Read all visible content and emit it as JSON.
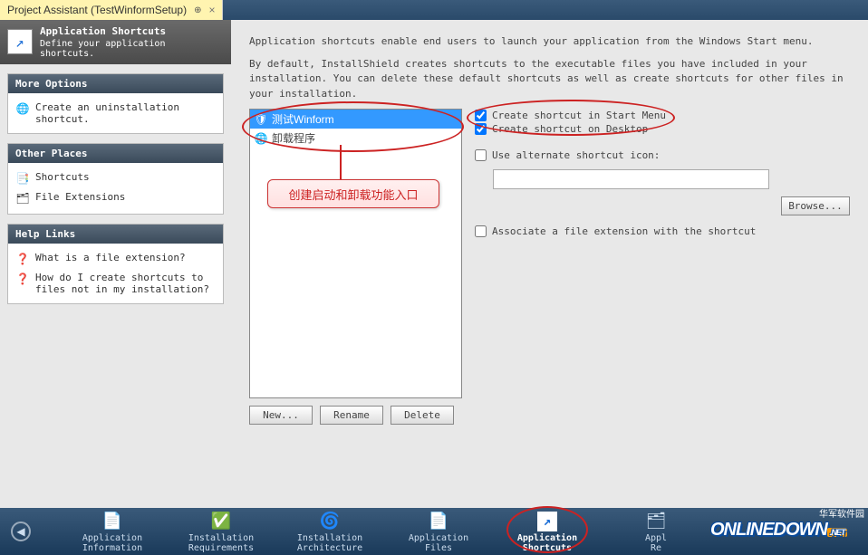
{
  "tab": {
    "title": "Project Assistant (TestWinformSetup)",
    "pin_glyph": "⊕",
    "close_glyph": "×"
  },
  "sidebar": {
    "header": {
      "title": "Application Shortcuts",
      "desc": "Define your application shortcuts.",
      "icon_glyph": "↗"
    },
    "panels": {
      "more_options": {
        "title": "More Options",
        "items": [
          {
            "icon": "🌐",
            "label": "Create an uninstallation shortcut."
          }
        ]
      },
      "other_places": {
        "title": "Other Places",
        "items": [
          {
            "icon": "📑",
            "label": "Shortcuts"
          },
          {
            "icon": "🗂",
            "label": "File Extensions"
          }
        ]
      },
      "help_links": {
        "title": "Help Links",
        "items": [
          {
            "icon": "❓",
            "label": "What is a file extension?"
          },
          {
            "icon": "❓",
            "label": "How do I create shortcuts to files not in my installation?"
          }
        ]
      }
    }
  },
  "content": {
    "para1": "Application shortcuts enable end users to launch your application from the Windows Start menu.",
    "para2": "By default, InstallShield creates shortcuts to the executable files you have included in your installation. You can delete these default shortcuts as well as create shortcuts for other files in your installation.",
    "shortcuts": [
      {
        "icon": "🛡",
        "label": "测试Winform",
        "selected": true
      },
      {
        "icon": "🌐",
        "label": "卸载程序",
        "selected": false
      }
    ],
    "buttons": {
      "new": "New...",
      "rename": "Rename",
      "delete": "Delete"
    },
    "options": {
      "create_start_menu": {
        "label": "Create shortcut in Start Menu",
        "checked": true
      },
      "create_desktop": {
        "label": "Create shortcut on Desktop",
        "checked": true
      },
      "alt_icon": {
        "label": "Use alternate shortcut icon:",
        "checked": false
      },
      "browse": "Browse...",
      "assoc_ext": {
        "label": "Associate a file extension with the shortcut",
        "checked": false
      }
    },
    "annotation": "创建启动和卸载功能入口"
  },
  "bottom_nav": {
    "items": [
      {
        "icon": "📄",
        "label1": "Application",
        "label2": "Information"
      },
      {
        "icon": "✅",
        "label1": "Installation",
        "label2": "Requirements"
      },
      {
        "icon": "🌀",
        "label1": "Installation",
        "label2": "Architecture"
      },
      {
        "icon": "📄",
        "label1": "Application",
        "label2": "Files"
      },
      {
        "icon": "↗",
        "label1": "Application",
        "label2": "Shortcuts",
        "active": true
      },
      {
        "icon": "🗂",
        "label1": "Appl",
        "label2": "Re"
      }
    ]
  },
  "watermark": {
    "brand_cn": "华军软件园",
    "brand_en": "ONLINEDOWN",
    "suffix": ".NET"
  }
}
